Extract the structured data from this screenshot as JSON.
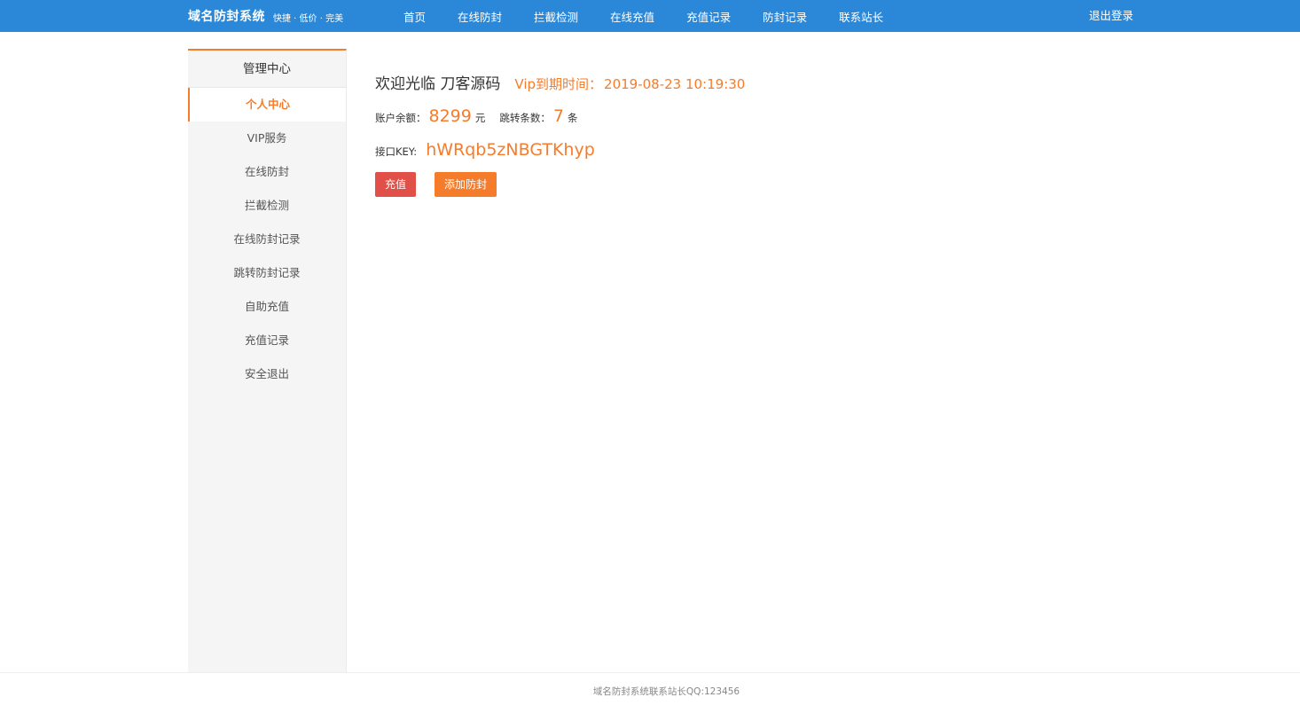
{
  "header": {
    "brand_name": "域名防封系统",
    "brand_slogan": "快捷 · 低价 · 完美",
    "nav": [
      {
        "label": "首页"
      },
      {
        "label": "在线防封"
      },
      {
        "label": "拦截检测"
      },
      {
        "label": "在线充值"
      },
      {
        "label": "充值记录"
      },
      {
        "label": "防封记录"
      },
      {
        "label": "联系站长"
      }
    ],
    "logout_label": "退出登录"
  },
  "sidebar": {
    "title": "管理中心",
    "items": [
      {
        "label": "个人中心",
        "active": true
      },
      {
        "label": "VIP服务"
      },
      {
        "label": "在线防封"
      },
      {
        "label": "拦截检测"
      },
      {
        "label": "在线防封记录"
      },
      {
        "label": "跳转防封记录"
      },
      {
        "label": "自助充值"
      },
      {
        "label": "充值记录"
      },
      {
        "label": "安全退出"
      }
    ]
  },
  "main": {
    "welcome": "欢迎光临 刀客源码",
    "vip_label": "Vip到期时间：",
    "vip_expiry": "2019-08-23 10:19:30",
    "balance_label": "账户余额：",
    "balance_value": "8299",
    "balance_unit": "元",
    "jumps_label": "跳转条数：",
    "jumps_value": "7",
    "jumps_unit": "条",
    "api_key_label": "接口KEY:",
    "api_key_value": "hWRqb5zNBGTKhyp",
    "recharge_button": "充值",
    "add_protect_button": "添加防封"
  },
  "footer": {
    "text": "域名防封系统联系站长QQ:123456"
  },
  "colors": {
    "header_bg": "#2b88d8",
    "accent": "#f57c2b",
    "danger": "#e04f48",
    "sidebar_bg": "#f5f5f5"
  }
}
